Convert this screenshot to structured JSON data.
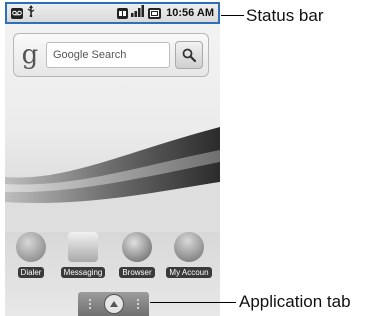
{
  "status_bar": {
    "icons": [
      "voicemail-icon",
      "usb-icon",
      "3g-icon",
      "signal-icon",
      "battery-icon"
    ],
    "time": "10:56 AM",
    "accent": "#2f6fb5"
  },
  "search_widget": {
    "logo": "g",
    "placeholder": "Google Search"
  },
  "dock": {
    "apps": [
      {
        "label": "Dialer",
        "icon": "phone-icon"
      },
      {
        "label": "Messaging",
        "icon": "messaging-icon"
      },
      {
        "label": "Browser",
        "icon": "globe-icon"
      },
      {
        "label": "My Accoun",
        "icon": "account-icon"
      }
    ]
  },
  "application_tab": {
    "icon": "chevron-up-icon"
  },
  "callouts": {
    "status_bar": "Status bar",
    "application_tab": "Application tab"
  }
}
